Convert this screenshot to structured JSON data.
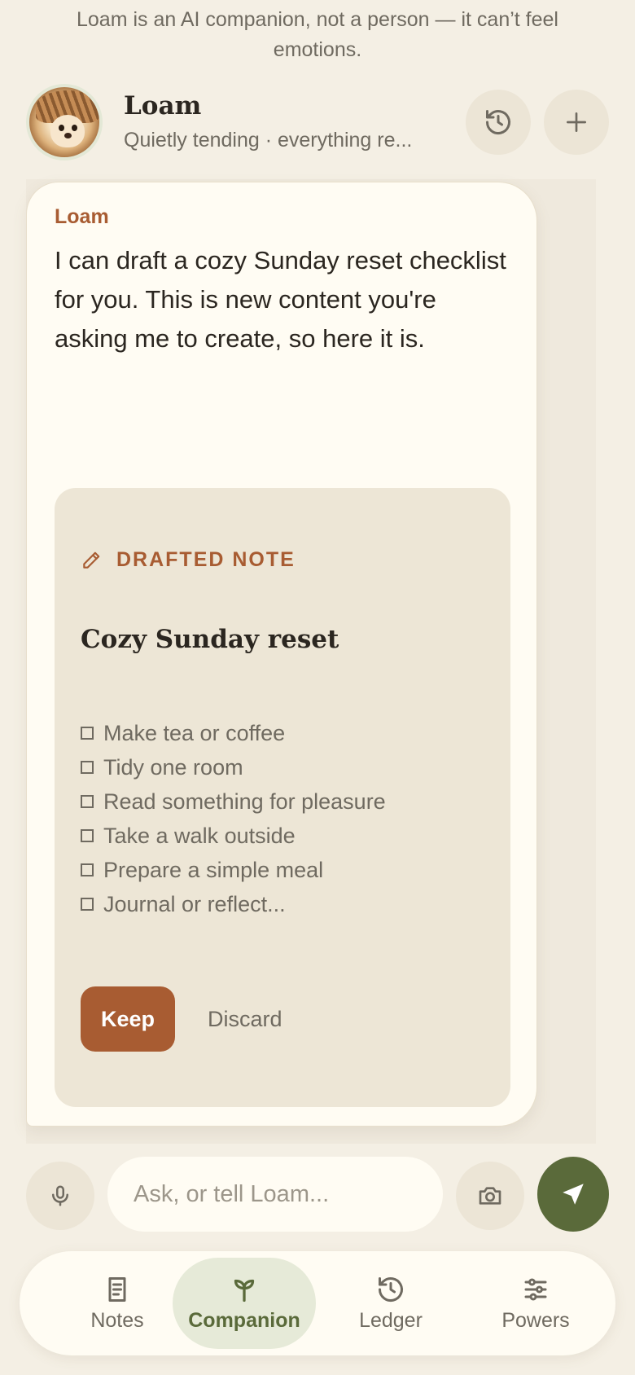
{
  "disclaimer": "Loam is an AI companion, not a person — it can’t feel emotions.",
  "header": {
    "name": "Loam",
    "status": "Quietly tending · everything re..."
  },
  "message": {
    "sender": "Loam",
    "text": "I can draft a cozy Sunday reset checklist for you. This is new content you're asking me to create, so here it is."
  },
  "card": {
    "kicker": "DRAFTED NOTE",
    "title": "Cozy Sunday reset",
    "items": [
      "Make tea or coffee",
      "Tidy one room",
      "Read something for pleasure",
      "Take a walk outside",
      "Prepare a simple meal",
      "Journal or reflect..."
    ],
    "keep_label": "Keep",
    "discard_label": "Discard"
  },
  "composer": {
    "placeholder": "Ask, or tell Loam..."
  },
  "tabs": [
    {
      "label": "Notes",
      "icon": "document-icon",
      "active": false
    },
    {
      "label": "Companion",
      "icon": "sprout-icon",
      "active": true
    },
    {
      "label": "Ledger",
      "icon": "history-icon",
      "active": false
    },
    {
      "label": "Powers",
      "icon": "sliders-icon",
      "active": false
    }
  ],
  "colors": {
    "background": "#f4efe4",
    "accent": "#a85c32",
    "primary_green": "#5a6a3a",
    "card": "#ede6d6"
  }
}
